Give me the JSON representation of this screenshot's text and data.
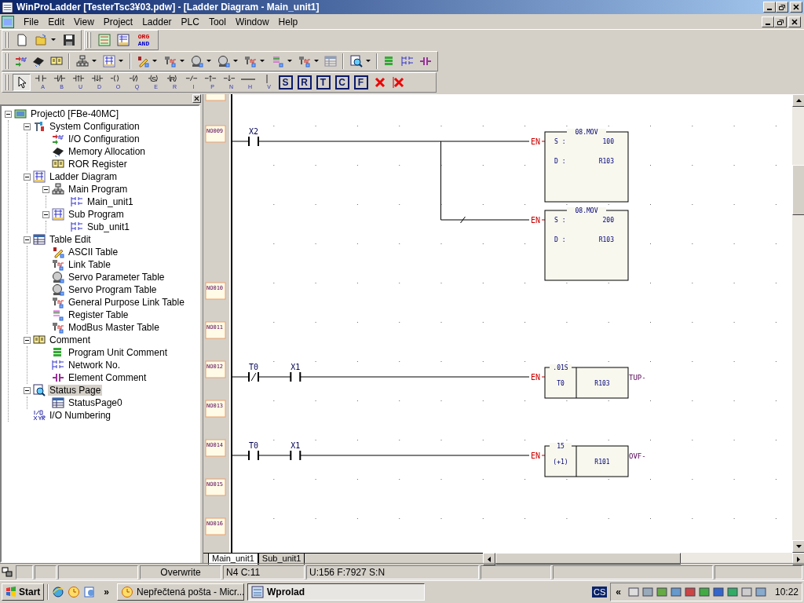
{
  "window": {
    "title": "WinProLadder [TesterTsc3¥03.pdw] - [Ladder Diagram - Main_unit1]"
  },
  "menu": [
    "File",
    "Edit",
    "View",
    "Project",
    "Ladder",
    "PLC",
    "Tool",
    "Window",
    "Help"
  ],
  "toolbar_file": [
    {
      "kind": "new",
      "dropdown": false
    },
    {
      "kind": "open",
      "dropdown": true
    },
    {
      "kind": "save",
      "dropdown": false
    }
  ],
  "toolbar_view": [
    {
      "kind": "ladder-view"
    },
    {
      "kind": "table-view"
    },
    {
      "kind": "mnemonic",
      "lines": [
        "ORG",
        "AND"
      ]
    }
  ],
  "toolbar_project": [
    {
      "kind": "io",
      "dropdown": false,
      "disabled": false
    },
    {
      "kind": "chip",
      "dropdown": false,
      "disabled": false
    },
    {
      "kind": "book",
      "dropdown": false,
      "disabled": false
    },
    {
      "kind": "separator"
    },
    {
      "kind": "hierarchy",
      "dropdown": true,
      "disabled": false
    },
    {
      "kind": "ladder",
      "dropdown": true,
      "disabled": false
    },
    {
      "kind": "separator"
    },
    {
      "kind": "pencil",
      "dropdown": true,
      "disabled": false
    },
    {
      "kind": "plug",
      "dropdown": true,
      "disabled": false
    },
    {
      "kind": "motor",
      "dropdown": true,
      "disabled": false
    },
    {
      "kind": "motor",
      "dropdown": true,
      "disabled": false
    },
    {
      "kind": "plug",
      "dropdown": true,
      "disabled": false
    },
    {
      "kind": "list",
      "dropdown": true,
      "disabled": false
    },
    {
      "kind": "plug",
      "dropdown": true,
      "disabled": false
    },
    {
      "kind": "table",
      "dropdown": false,
      "disabled": true
    },
    {
      "kind": "separator"
    },
    {
      "kind": "magnifier",
      "dropdown": true,
      "disabled": false
    },
    {
      "kind": "separator"
    },
    {
      "kind": "comment-lines",
      "dropdown": false,
      "disabled": false
    },
    {
      "kind": "rung",
      "dropdown": false,
      "disabled": false
    },
    {
      "kind": "contact",
      "dropdown": false,
      "disabled": false
    }
  ],
  "toolbar_ladder": [
    {
      "kind": "pointer",
      "selected": true
    },
    {
      "kind": "contact-no",
      "key": "A",
      "selected": false
    },
    {
      "kind": "contact-nc",
      "key": "B",
      "selected": false
    },
    {
      "kind": "contact-up",
      "key": "U",
      "selected": false
    },
    {
      "kind": "contact-down",
      "key": "D",
      "selected": false
    },
    {
      "kind": "coil",
      "key": "O",
      "selected": false
    },
    {
      "kind": "coil-neg",
      "key": "Q",
      "selected": false
    },
    {
      "kind": "coil-set",
      "symbol": "S",
      "key": "E",
      "selected": false
    },
    {
      "kind": "coil-reset",
      "symbol": "R",
      "key": "R",
      "selected": false
    },
    {
      "kind": "invert",
      "key": "I",
      "selected": false
    },
    {
      "kind": "pulse-up",
      "key": "P",
      "selected": false
    },
    {
      "kind": "pulse-down",
      "key": "N",
      "selected": false
    },
    {
      "kind": "hline",
      "key": "H",
      "selected": false
    },
    {
      "kind": "vline",
      "key": "V",
      "selected": false
    },
    {
      "kind": "letter",
      "label": "S",
      "selected": false
    },
    {
      "kind": "letter",
      "label": "R",
      "selected": false
    },
    {
      "kind": "letter",
      "label": "T",
      "selected": false
    },
    {
      "kind": "letter",
      "label": "C",
      "selected": false
    },
    {
      "kind": "letter",
      "label": "F",
      "selected": false
    },
    {
      "kind": "delete",
      "selected": false
    },
    {
      "kind": "delete-vline",
      "selected": false
    }
  ],
  "tree": [
    {
      "label": "Project0 [FBe-40MC]",
      "kind": "monitor",
      "expanded": true,
      "selected": false,
      "children": [
        {
          "label": "System Configuration",
          "kind": "tools",
          "expanded": true,
          "selected": false,
          "children": [
            {
              "label": "I/O Configuration",
              "kind": "io",
              "selected": false
            },
            {
              "label": "Memory Allocation",
              "kind": "chip",
              "selected": false
            },
            {
              "label": "ROR Register",
              "kind": "book",
              "selected": false
            }
          ]
        },
        {
          "label": "Ladder Diagram",
          "kind": "ladder",
          "expanded": true,
          "selected": false,
          "children": [
            {
              "label": "Main Program",
              "kind": "hierarchy",
              "expanded": true,
              "selected": false,
              "children": [
                {
                  "label": "Main_unit1",
                  "kind": "rung",
                  "selected": false
                }
              ]
            },
            {
              "label": "Sub Program",
              "kind": "ladder",
              "expanded": true,
              "selected": false,
              "children": [
                {
                  "label": "Sub_unit1",
                  "kind": "rung",
                  "selected": false
                }
              ]
            }
          ]
        },
        {
          "label": "Table Edit",
          "kind": "table",
          "expanded": true,
          "selected": false,
          "children": [
            {
              "label": "ASCII Table",
              "kind": "pencil",
              "selected": false
            },
            {
              "label": "Link Table",
              "kind": "plug",
              "selected": false
            },
            {
              "label": "Servo Parameter Table",
              "kind": "motor",
              "selected": false
            },
            {
              "label": "Servo Program Table",
              "kind": "motor",
              "selected": false
            },
            {
              "label": "General Purpose Link Table",
              "kind": "plug",
              "selected": false
            },
            {
              "label": "Register Table",
              "kind": "list",
              "selected": false
            },
            {
              "label": "ModBus Master Table",
              "kind": "plug",
              "selected": false
            }
          ]
        },
        {
          "label": "Comment",
          "kind": "book",
          "expanded": true,
          "selected": false,
          "children": [
            {
              "label": "Program Unit Comment",
              "kind": "comment-lines",
              "selected": false
            },
            {
              "label": "Network No.",
              "kind": "rung",
              "selected": false
            },
            {
              "label": "Element Comment",
              "kind": "contact",
              "selected": false
            }
          ]
        },
        {
          "label": "Status Page",
          "kind": "magnifier",
          "expanded": true,
          "selected": true,
          "children": [
            {
              "label": "StatusPage0",
              "kind": "table",
              "selected": false
            }
          ]
        },
        {
          "label": "I/O Numbering",
          "kind": "numbering",
          "selected": false
        }
      ]
    }
  ],
  "networks": [
    {
      "number": "NO009",
      "branches": [
        {
          "kind": "main",
          "elements": [
            {
              "kind": "contact-no",
              "label": "X2"
            }
          ],
          "block": {
            "kind": "mov",
            "input": "EN",
            "title": "08.MOV",
            "operands": [
              {
                "name": "S :",
                "value": "100"
              },
              {
                "name": "D :",
                "value": "R103"
              }
            ]
          }
        },
        {
          "kind": "parallel",
          "elements": [
            {
              "kind": "invert"
            }
          ],
          "block": {
            "kind": "mov",
            "input": "EN",
            "title": "08.MOV",
            "operands": [
              {
                "name": "S :",
                "value": "200"
              },
              {
                "name": "D :",
                "value": "R103"
              }
            ]
          }
        }
      ]
    },
    {
      "number": "NO010"
    },
    {
      "number": "NO011"
    },
    {
      "number": "NO012",
      "branches": [
        {
          "kind": "main",
          "elements": [
            {
              "kind": "contact-nc",
              "label": "T0"
            },
            {
              "kind": "contact-no",
              "label": "X1"
            }
          ],
          "block": {
            "kind": "split",
            "input": "EN",
            "title": ".01S",
            "left": "T0",
            "right": "R103",
            "output": "TUP-"
          }
        }
      ]
    },
    {
      "number": "NO013"
    },
    {
      "number": "NO014",
      "branches": [
        {
          "kind": "main",
          "elements": [
            {
              "kind": "contact-no",
              "label": "T0"
            },
            {
              "kind": "contact-no",
              "label": "X1"
            }
          ],
          "block": {
            "kind": "split",
            "input": "EN",
            "title": "15",
            "left": "(+1)",
            "right": "R101",
            "output": "OVF-"
          }
        }
      ]
    },
    {
      "number": "NO015"
    },
    {
      "number": "NO016"
    }
  ],
  "sheet_tabs": [
    {
      "label": "Main_unit1",
      "selected": true
    },
    {
      "label": "Sub_unit1",
      "selected": false
    }
  ],
  "status_bar": {
    "mode": "Overwrite",
    "position": "N4 C:11",
    "memory": "U:156 F:7927 S:N"
  },
  "taskbar": {
    "start": "Start",
    "more": "»",
    "tasks": [
      {
        "label": "Nepřečtená pošta - Micr...",
        "kind": "mail",
        "selected": false
      },
      {
        "label": "Wprolad",
        "kind": "ladder",
        "selected": true
      }
    ],
    "language": "CS",
    "tray_expand": "«",
    "clock": "10:22"
  }
}
